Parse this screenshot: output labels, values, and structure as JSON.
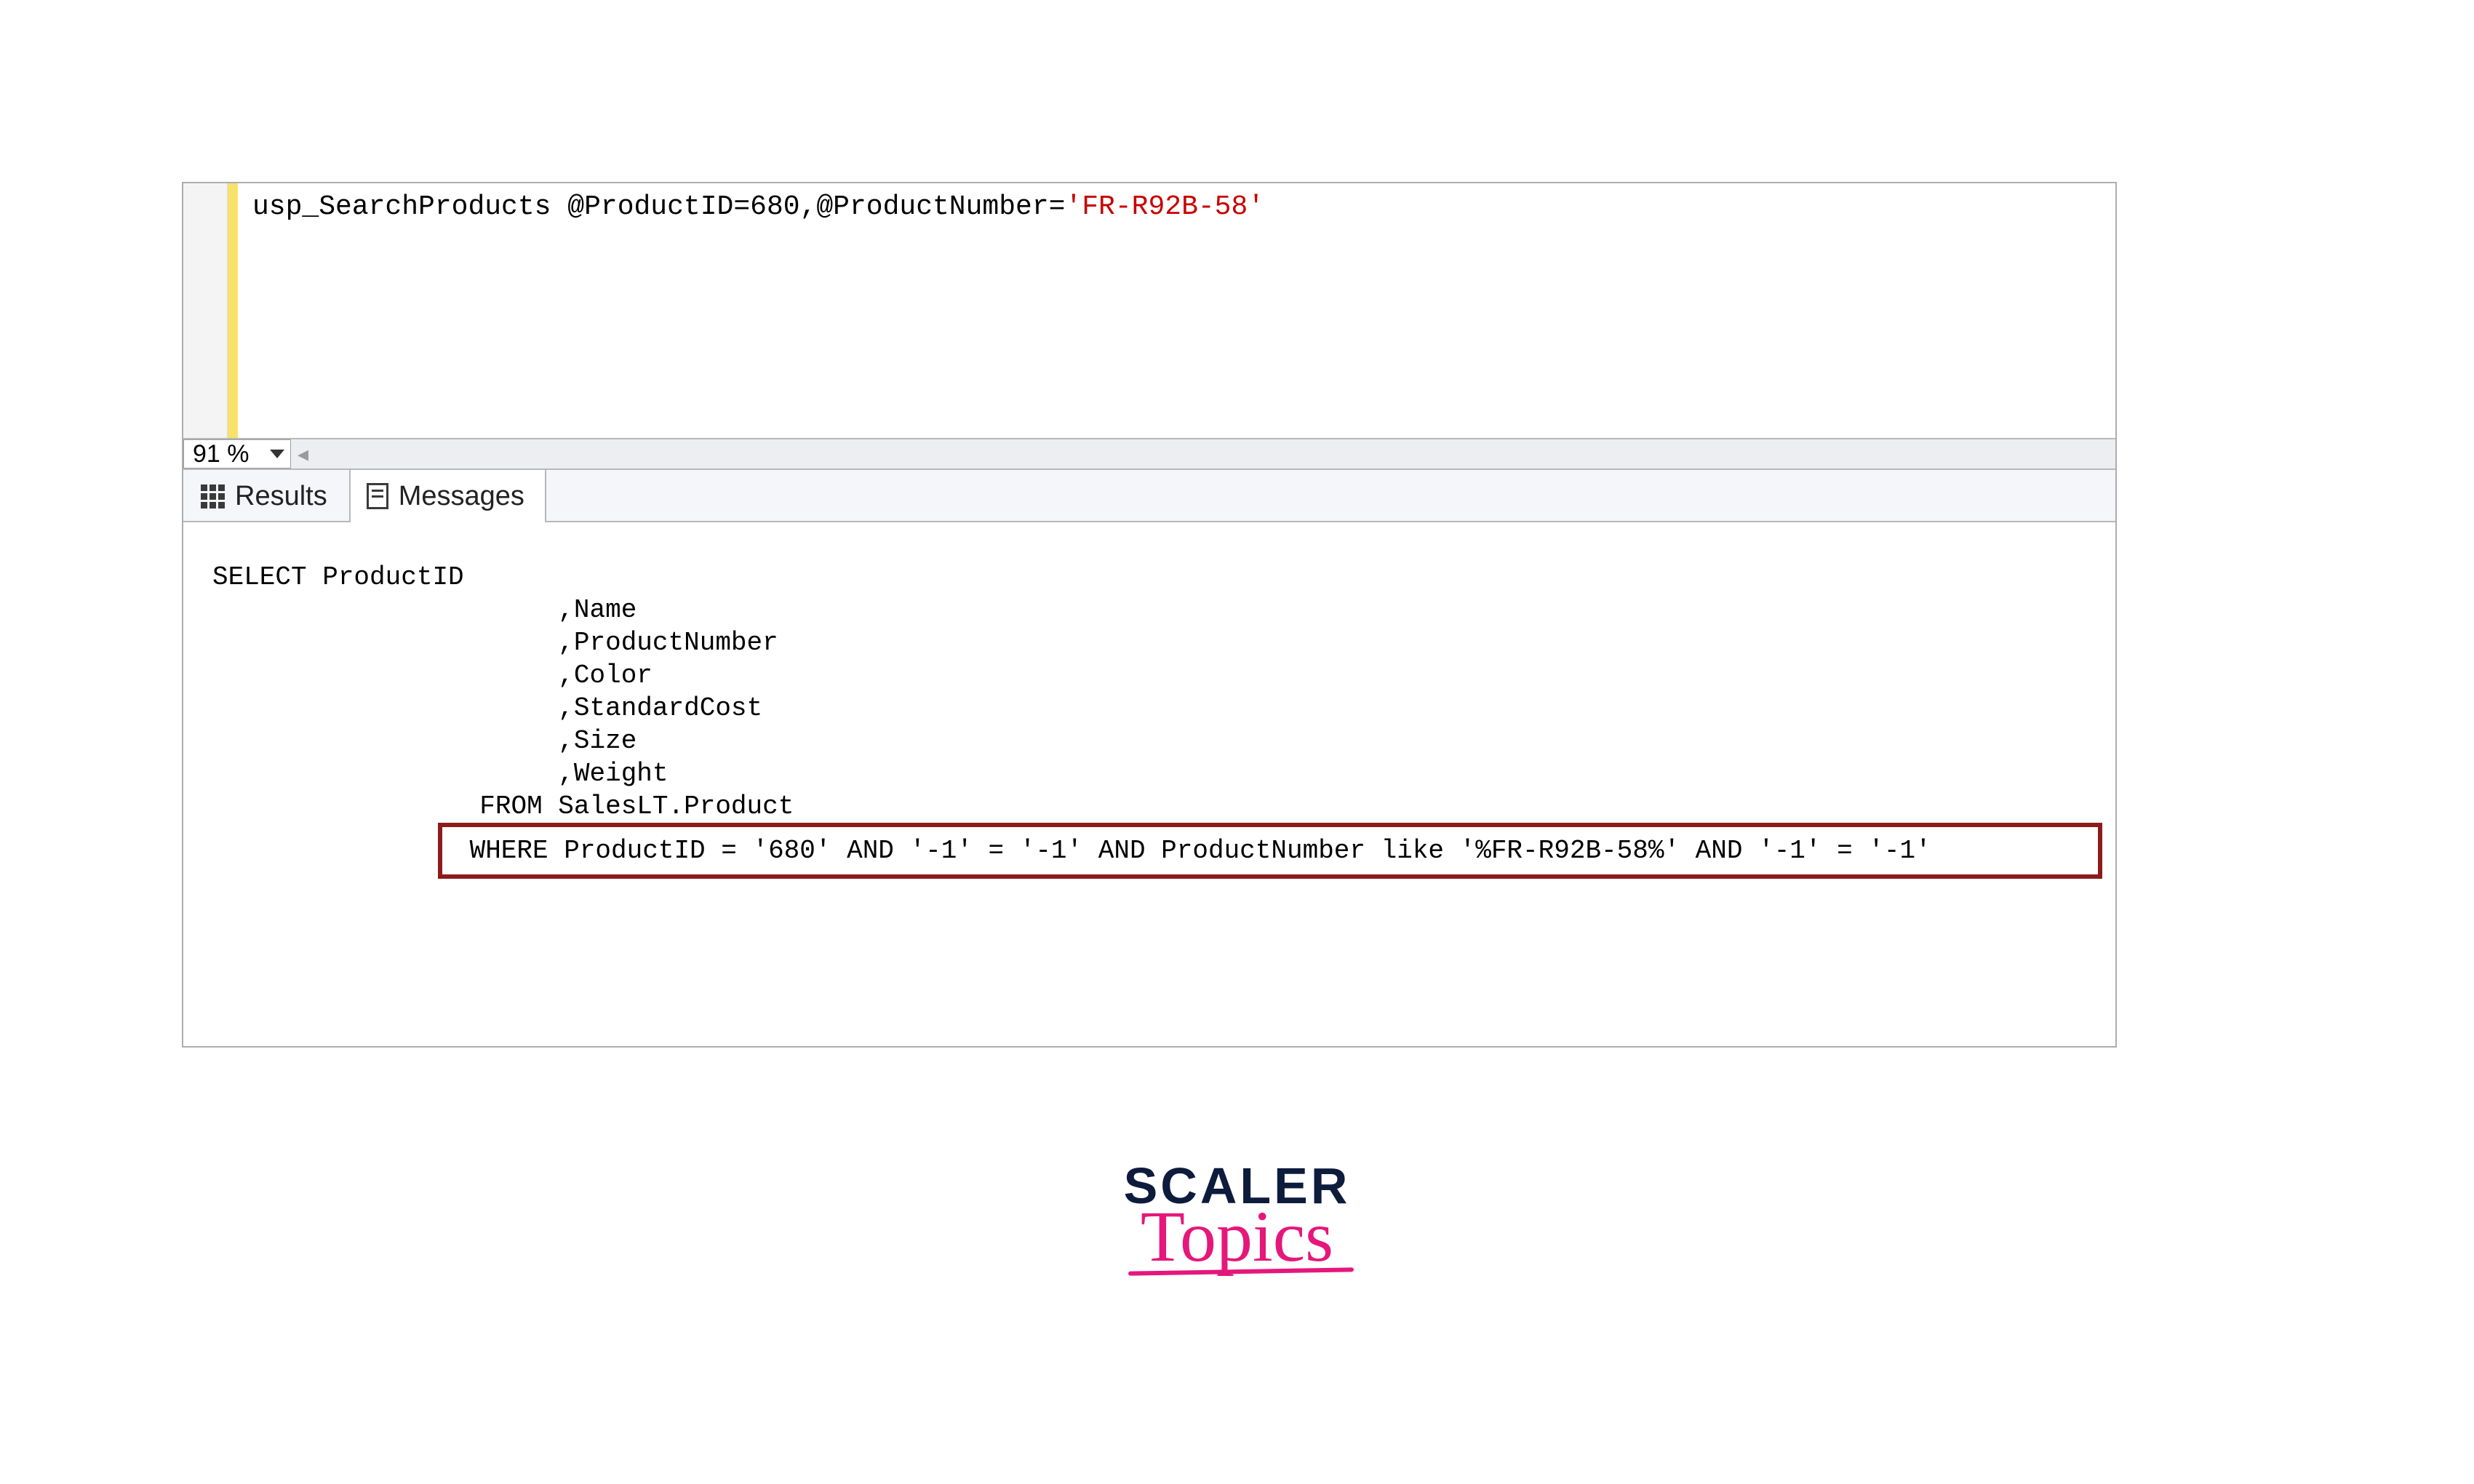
{
  "editor": {
    "zoom_level": "91 %",
    "query": {
      "proc_name": "usp_SearchProducts",
      "param1_name": "@ProductID",
      "param1_value": "680",
      "param2_name": "@ProductNumber",
      "param2_string": "'FR-R92B-58'"
    }
  },
  "tabs": {
    "results_label": "Results",
    "messages_label": "Messages",
    "active": "messages"
  },
  "messages": {
    "line1": "SELECT ProductID",
    "line2": "                      ,Name",
    "line3": "                      ,ProductNumber",
    "line4": "                      ,Color",
    "line5": "                      ,StandardCost",
    "line6": "                      ,Size",
    "line7": "                      ,Weight",
    "line8": "                 FROM SalesLT.Product",
    "highlighted": " WHERE ProductID = '680' AND '-1' = '-1' AND ProductNumber like '%FR-R92B-58%' AND '-1' = '-1'"
  },
  "watermark": {
    "line1": "SCALER",
    "line2": "Topics"
  }
}
